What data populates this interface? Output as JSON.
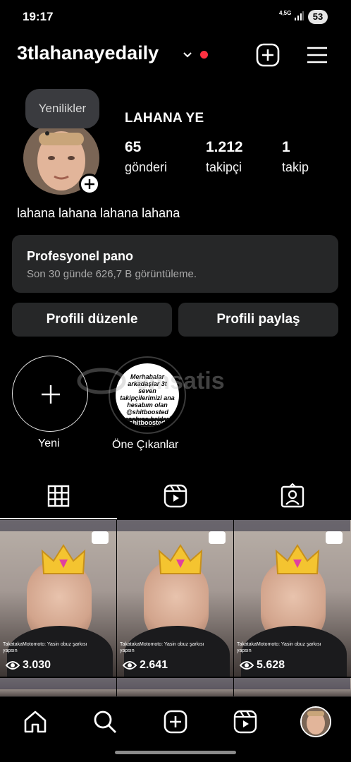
{
  "status_bar": {
    "time": "19:17",
    "network": "4,5G",
    "battery": "53"
  },
  "header": {
    "username": "3tlahanayedaily"
  },
  "profile": {
    "tooltip": "Yenilikler",
    "display_name": "LAHANA YE",
    "stats": [
      {
        "value": "65",
        "label": "gönderi"
      },
      {
        "value": "1.212",
        "label": "takipçi"
      },
      {
        "value": "1",
        "label": "takip"
      }
    ],
    "bio": "lahana lahana lahana lahana"
  },
  "dashboard": {
    "title": "Profesyonel pano",
    "subtitle": "Son 30 günde 626,7 B görüntüleme."
  },
  "actions": {
    "edit": "Profili düzenle",
    "share": "Profili paylaş"
  },
  "highlights": {
    "new_label": "Yeni",
    "items": [
      {
        "label": "Öne Çıkanlar",
        "cover_text": "Merhabalar arkadaşlar 3t seven takipçilerimizi ana hesabım olan @shitboosted hesabına bekleriz",
        "cover_strip": "shitboosted"
      }
    ]
  },
  "watermark": "emsatis",
  "posts": [
    {
      "views": "3.030",
      "chat": "TakatakaMotomoto: Yasin obuz şarkısı yapsın"
    },
    {
      "views": "2.641",
      "chat": "TakatakaMotomoto: Yasin obuz şarkısı yapsın"
    },
    {
      "views": "5.628",
      "chat": "TakatakaMotomoto: Yasin obuz şarkısı yapsın"
    }
  ],
  "colors": {
    "background": "#000000",
    "card": "#262728",
    "notification_dot": "#ff3040"
  },
  "icons": [
    "chevron-down-icon",
    "plus-square-icon",
    "hamburger-menu-icon",
    "grid-icon",
    "reels-icon",
    "tagged-icon",
    "home-icon",
    "search-icon",
    "eye-icon"
  ]
}
